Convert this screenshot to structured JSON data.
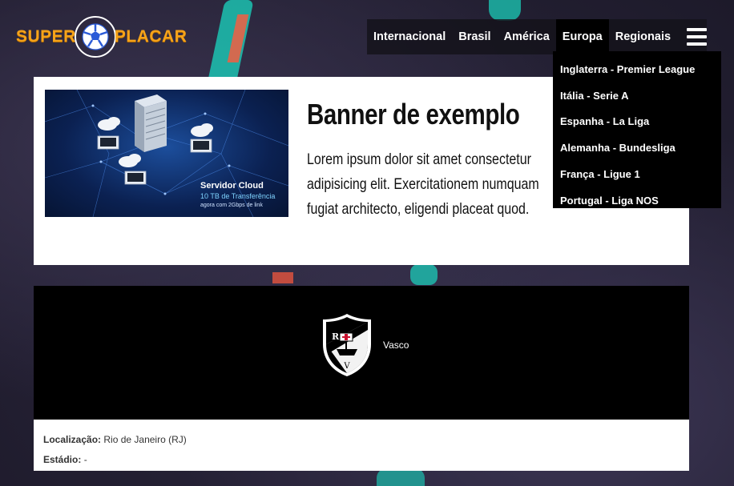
{
  "brand": {
    "left_word": "SUPER",
    "right_word": "PLACAR",
    "accent_color": "#f5a31a"
  },
  "nav": {
    "items": [
      {
        "label": "Internacional"
      },
      {
        "label": "Brasil"
      },
      {
        "label": "América"
      },
      {
        "label": "Europa",
        "active": true
      },
      {
        "label": "Regionais"
      }
    ],
    "menu_icon": "hamburger-menu-icon"
  },
  "dropdown": {
    "items": [
      {
        "label": "Inglaterra - Premier League"
      },
      {
        "label": "Itália - Serie A"
      },
      {
        "label": "Espanha - La Liga"
      },
      {
        "label": "Alemanha - Bundesliga"
      },
      {
        "label": "França - Ligue 1"
      },
      {
        "label": "Portugal - Liga NOS"
      }
    ]
  },
  "banner": {
    "title": "Banner de exemplo",
    "text": "Lorem ipsum dolor sit amet consectetur adipisicing elit. Exercitationem numquam fugiat architecto, eligendi placeat quod.",
    "image": {
      "caption_title": "Servidor Cloud",
      "caption_sub": "10 TB de Transferência",
      "caption_small": "agora com 2Gbps de link"
    }
  },
  "team": {
    "name": "Vasco",
    "crest_icon": "vasco-crest-icon"
  },
  "info": {
    "location_label": "Localização:",
    "location_value": "Rio de Janeiro (RJ)",
    "stadium_label": "Estádio:",
    "stadium_value": "-"
  }
}
